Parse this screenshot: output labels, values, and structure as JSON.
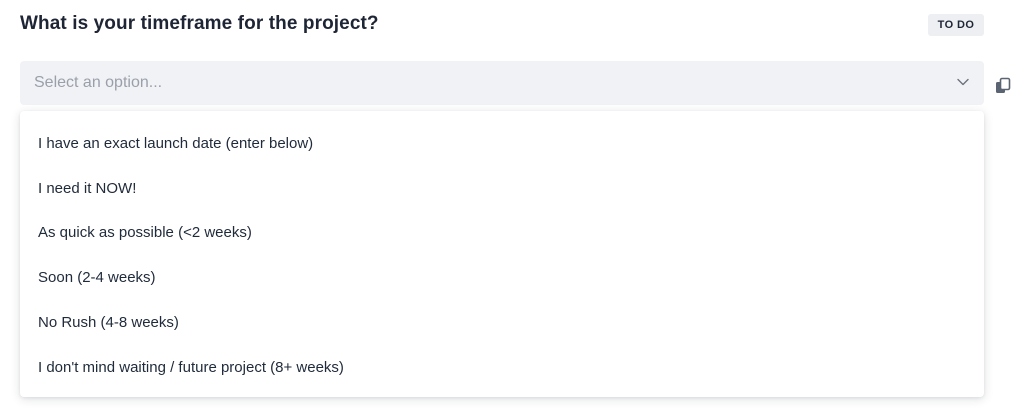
{
  "question": "What is your timeframe for the project?",
  "status_badge": "TO DO",
  "select": {
    "placeholder": "Select an option..."
  },
  "options": [
    "I have an exact launch date (enter below)",
    "I need it NOW!",
    "As quick as possible (<2 weeks)",
    "Soon (2-4 weeks)",
    "No Rush (4-8 weeks)",
    "I don't mind waiting / future project (8+ weeks)"
  ],
  "icons": {
    "chevron": "chevron-down-icon",
    "copy": "copy-icon"
  }
}
